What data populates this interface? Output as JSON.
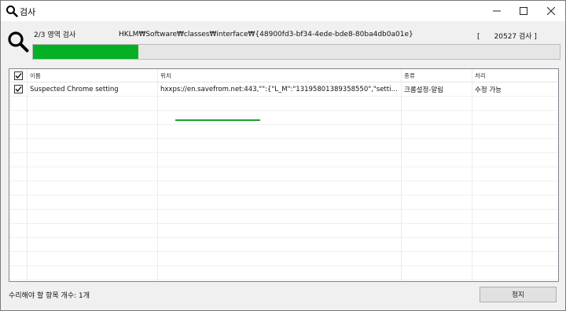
{
  "window": {
    "title": "검사",
    "icon": "search-icon",
    "controls": [
      "minimize-icon",
      "maximize-icon",
      "close-icon"
    ]
  },
  "scan": {
    "area_label": "2/3 영역 검사",
    "current_path": "HKLM₩Software₩classes₩interface₩{48900fd3-bf34-4ede-bde8-80ba4db0a01e}",
    "count_open": "[",
    "count_value": "20527 검사 ]",
    "progress_fraction": 0.2,
    "progress_color": "#06b025"
  },
  "table": {
    "columns": [
      "이름",
      "위치",
      "종류",
      "처리"
    ],
    "rows": [
      {
        "checked": true,
        "name": "Suspected Chrome setting",
        "location": "hxxps://en.savefrom.net:443,\"\":{\"L_M\":\"13195801389358550\",\"setti…",
        "type": "크롬설정-알림",
        "action": "수정 가능"
      }
    ]
  },
  "footer": {
    "items_to_fix": "수리해야 할 항목 개수: 1개",
    "stop_label": "정지"
  }
}
